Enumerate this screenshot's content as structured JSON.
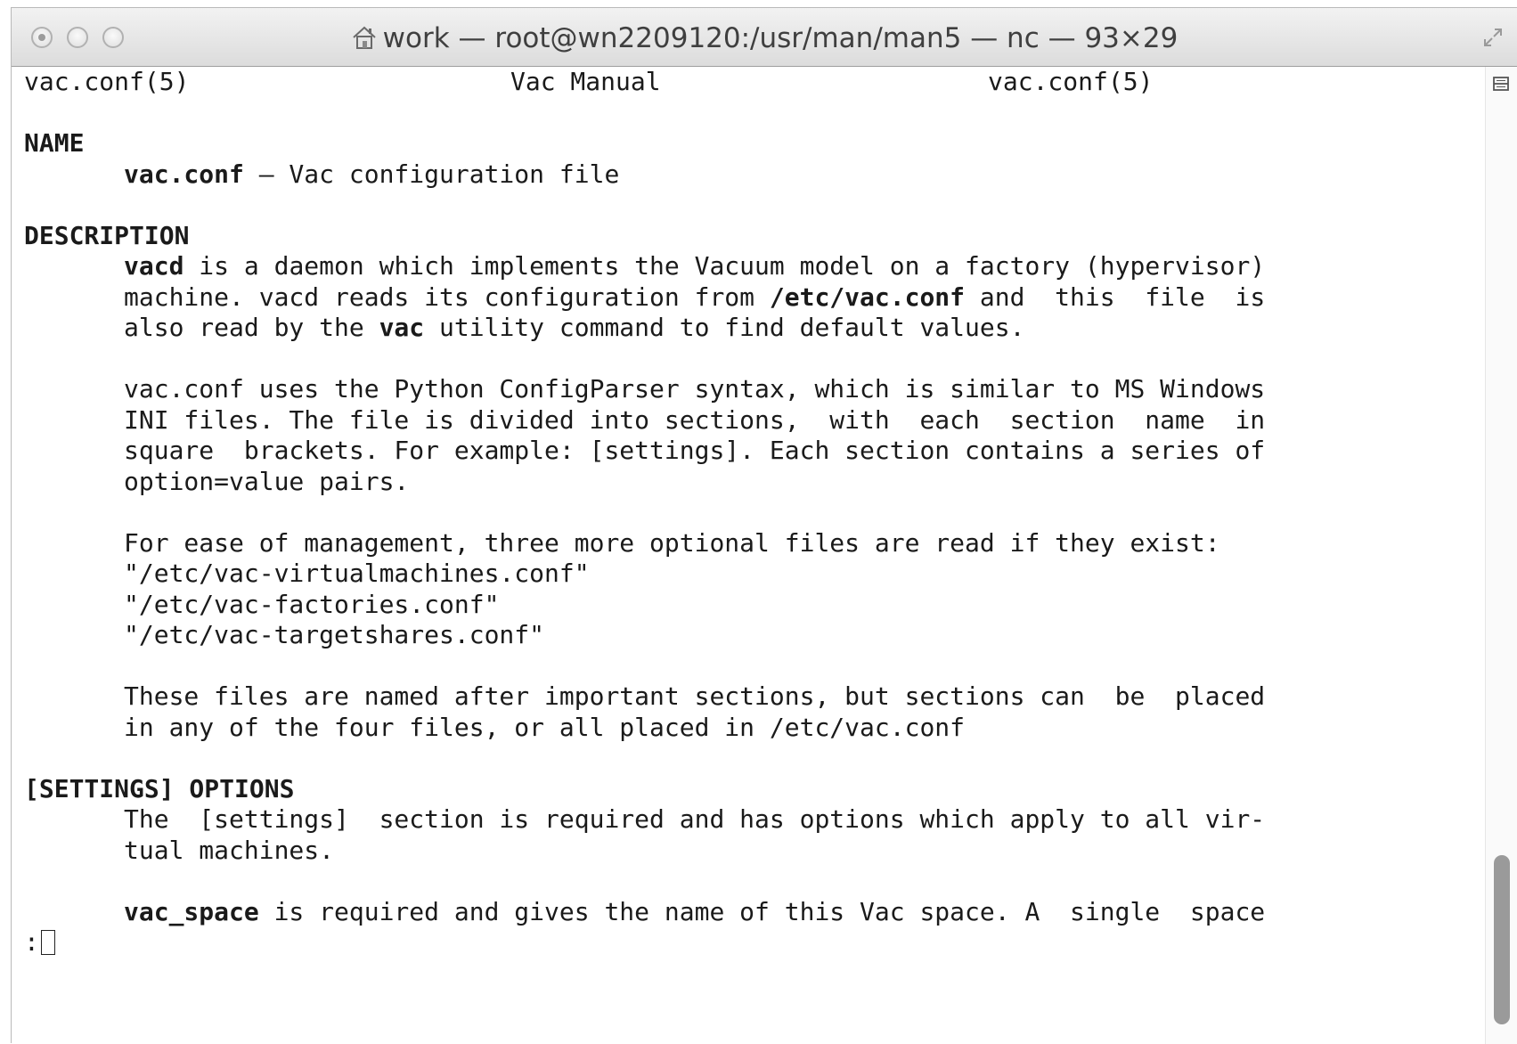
{
  "window": {
    "title": "work — root@wn2209120:/usr/man/man5 — nc — 93×29"
  },
  "icons": {
    "window_title": "home-icon",
    "fullscreen": "resize-icon",
    "scrollbar_top": "split-handle-icon"
  },
  "man_header": {
    "left": "vac.conf(5)",
    "center": "Vac Manual",
    "right": "vac.conf(5)"
  },
  "name_section": {
    "heading": "NAME",
    "command": "vac.conf",
    "description": " – Vac configuration file"
  },
  "description_section": {
    "heading": "DESCRIPTION",
    "p1_l1_cmd": "vacd",
    "p1_l1_rest": " is a daemon which implements the Vacuum model on a factory (hypervisor)",
    "p1_l2_start": "machine. vacd reads its configuration from ",
    "p1_l2_path": "/etc/vac.conf",
    "p1_l2_end": " and  this  file  is",
    "p1_l3_start": "also read by the ",
    "p1_l3_cmd": "vac",
    "p1_l3_end": " utility command to find default values.",
    "p2_lines": [
      "vac.conf uses the Python ConfigParser syntax, which is similar to MS Windows",
      "INI files. The file is divided into sections,  with  each  section  name  in",
      "square  brackets. For example: [settings]. Each section contains a series of",
      "option=value pairs."
    ],
    "p3_lines": [
      "For ease of management, three more optional files are read if they exist:",
      "\"/etc/vac-virtualmachines.conf\"",
      "\"/etc/vac-factories.conf\"",
      "\"/etc/vac-targetshares.conf\""
    ],
    "p4_lines": [
      "These files are named after important sections, but sections can  be  placed",
      "in any of the four files, or all placed in /etc/vac.conf"
    ]
  },
  "settings_section": {
    "heading": "[SETTINGS] OPTIONS",
    "p1_lines": [
      "The  [settings]  section is required and has options which apply to all vir-",
      "tual machines."
    ],
    "p2_cmd": "vac_space",
    "p2_rest": " is required and gives the name of this Vac space. A  single  space"
  },
  "pager": {
    "prompt": ":"
  },
  "scrollbar": {
    "position_fraction": 0.82
  }
}
